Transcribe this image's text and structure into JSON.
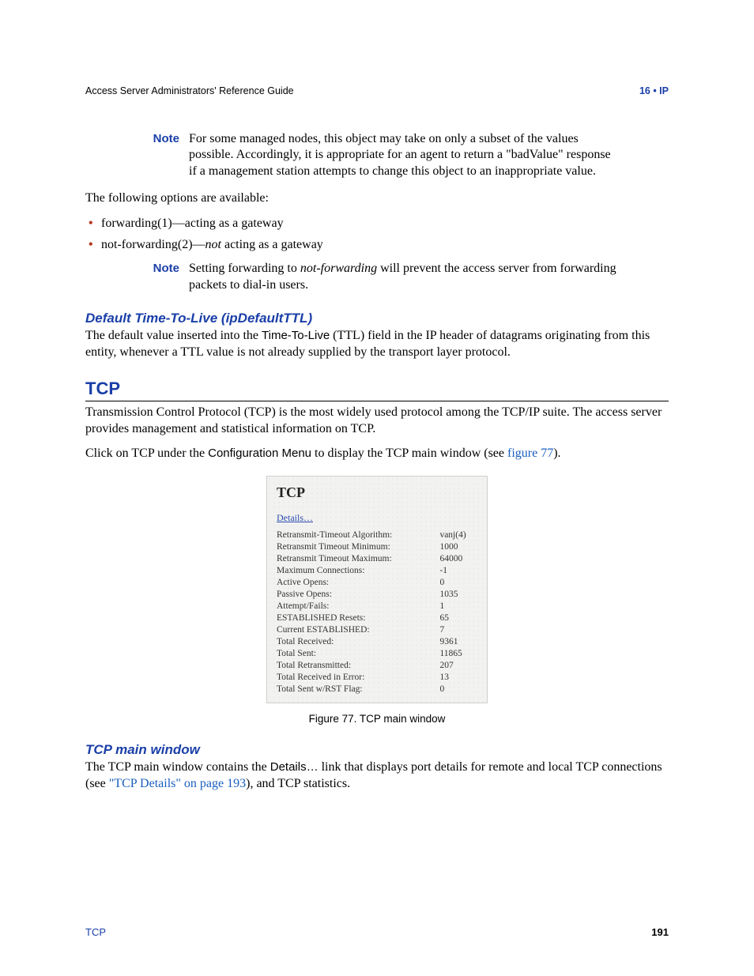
{
  "header": {
    "guide": "Access Server Administrators' Reference Guide",
    "chapter": "16 • IP"
  },
  "note1": {
    "label": "Note",
    "text": "For some managed nodes, this object may take on only a subset of the values possible. Accordingly, it is appropriate for an agent to return a \"badValue\" response if a management station attempts to change this object to an inappropriate value."
  },
  "options_intro": "The following options are available:",
  "bullets": {
    "b1": "forwarding(1)—acting as a gateway",
    "b2_prefix": "not-forwarding(2)—",
    "b2_em": "not",
    "b2_suffix": " acting as a gateway"
  },
  "note2": {
    "label": "Note",
    "pre": "Setting forwarding to ",
    "em": "not-forwarding",
    "post": " will prevent the access server from forwarding packets to dial-in users."
  },
  "ttl": {
    "heading": "Default Time-To-Live (ipDefaultTTL)",
    "p_pre": "The default value inserted into the ",
    "p_sans": "Time-To-Live",
    "p_post": " (TTL) field in the IP header of datagrams originating from this entity, whenever a TTL value is not already supplied by the transport layer protocol."
  },
  "tcp": {
    "heading": "TCP",
    "intro": "Transmission Control Protocol (TCP) is the most widely used protocol among the TCP/IP suite. The access server provides management and statistical information on TCP.",
    "click_pre": "Click on TCP under the ",
    "click_sans": "Configuration Menu",
    "click_mid": " to display the TCP main window (see ",
    "click_link": "figure 77",
    "click_post": ")."
  },
  "figure": {
    "title": "TCP",
    "details_link": "Details…",
    "rows": [
      {
        "label": "Retransmit-Timeout Algorithm:",
        "value": "vanj(4)"
      },
      {
        "label": "Retransmit Timeout Minimum:",
        "value": "1000"
      },
      {
        "label": "Retransmit Timeout Maximum:",
        "value": "64000"
      },
      {
        "label": "Maximum Connections:",
        "value": "-1"
      },
      {
        "label": "Active Opens:",
        "value": "0"
      },
      {
        "label": "Passive Opens:",
        "value": "1035"
      },
      {
        "label": "Attempt/Fails:",
        "value": "1"
      },
      {
        "label": "ESTABLISHED Resets:",
        "value": "65"
      },
      {
        "label": "Current ESTABLISHED:",
        "value": "7"
      },
      {
        "label": "Total Received:",
        "value": "9361"
      },
      {
        "label": "Total Sent:",
        "value": "11865"
      },
      {
        "label": "Total Retransmitted:",
        "value": "207"
      },
      {
        "label": "Total Received in Error:",
        "value": "13"
      },
      {
        "label": "Total Sent w/RST Flag:",
        "value": "0"
      }
    ],
    "caption": "Figure 77. TCP main window"
  },
  "tcp_main": {
    "heading": "TCP main window",
    "p_pre": "The TCP main window contains the ",
    "p_sans": "Details…",
    "p_mid": " link that displays port details for remote and local TCP connections (see ",
    "p_link": "\"TCP Details\"",
    "p_link_tail": " on page 193",
    "p_post": "), and TCP statistics."
  },
  "footer": {
    "left": "TCP",
    "page": "191"
  }
}
